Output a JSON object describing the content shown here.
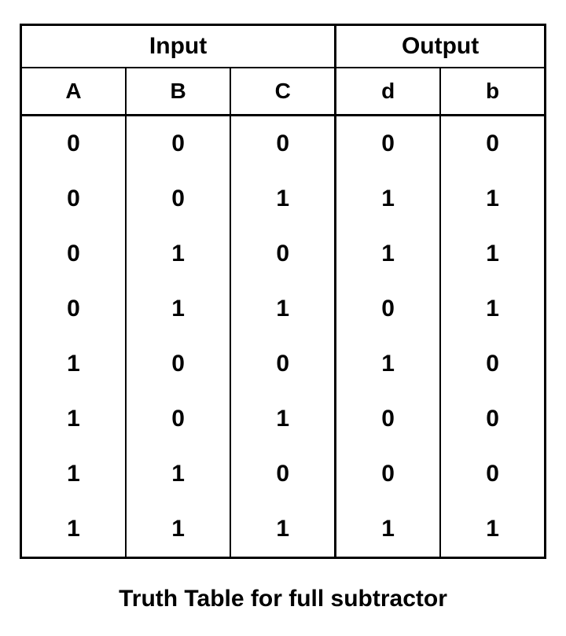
{
  "caption": "Truth Table for full subtractor",
  "group_headers": {
    "input": "Input",
    "output": "Output"
  },
  "column_headers": {
    "A": "A",
    "B": "B",
    "C": "C",
    "d": "d",
    "b": "b"
  },
  "rows": [
    {
      "A": "0",
      "B": "0",
      "C": "0",
      "d": "0",
      "b": "0"
    },
    {
      "A": "0",
      "B": "0",
      "C": "1",
      "d": "1",
      "b": "1"
    },
    {
      "A": "0",
      "B": "1",
      "C": "0",
      "d": "1",
      "b": "1"
    },
    {
      "A": "0",
      "B": "1",
      "C": "1",
      "d": "0",
      "b": "1"
    },
    {
      "A": "1",
      "B": "0",
      "C": "0",
      "d": "1",
      "b": "0"
    },
    {
      "A": "1",
      "B": "0",
      "C": "1",
      "d": "0",
      "b": "0"
    },
    {
      "A": "1",
      "B": "1",
      "C": "0",
      "d": "0",
      "b": "0"
    },
    {
      "A": "1",
      "B": "1",
      "C": "1",
      "d": "1",
      "b": "1"
    }
  ]
}
